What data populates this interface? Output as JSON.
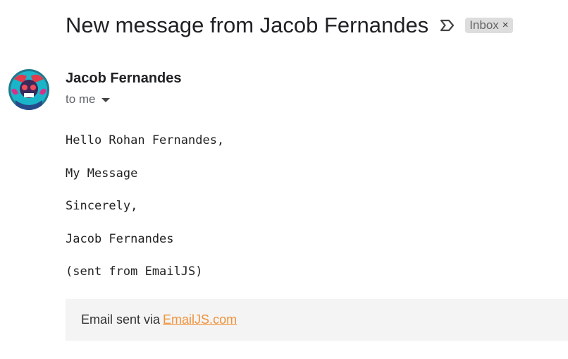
{
  "email": {
    "subject": "New message from Jacob Fernandes",
    "label": "Inbox",
    "label_close": "×",
    "sender_name": "Jacob Fernandes",
    "recipient_text": "to me",
    "body_lines": [
      "Hello Rohan Fernandes,",
      "My Message",
      "Sincerely,",
      "Jacob Fernandes",
      "(sent from EmailJS)"
    ],
    "footer": {
      "prefix": "Email sent via",
      "link_text": "EmailJS.com"
    }
  },
  "icons": {
    "important": "important-marker-icon",
    "caret": "caret-down-icon",
    "avatar": "sender-avatar"
  },
  "colors": {
    "link": "#f0923a",
    "chip_bg": "#dddddd",
    "footer_bg": "#f4f4f4",
    "text": "#202124",
    "muted": "#5f6368"
  }
}
